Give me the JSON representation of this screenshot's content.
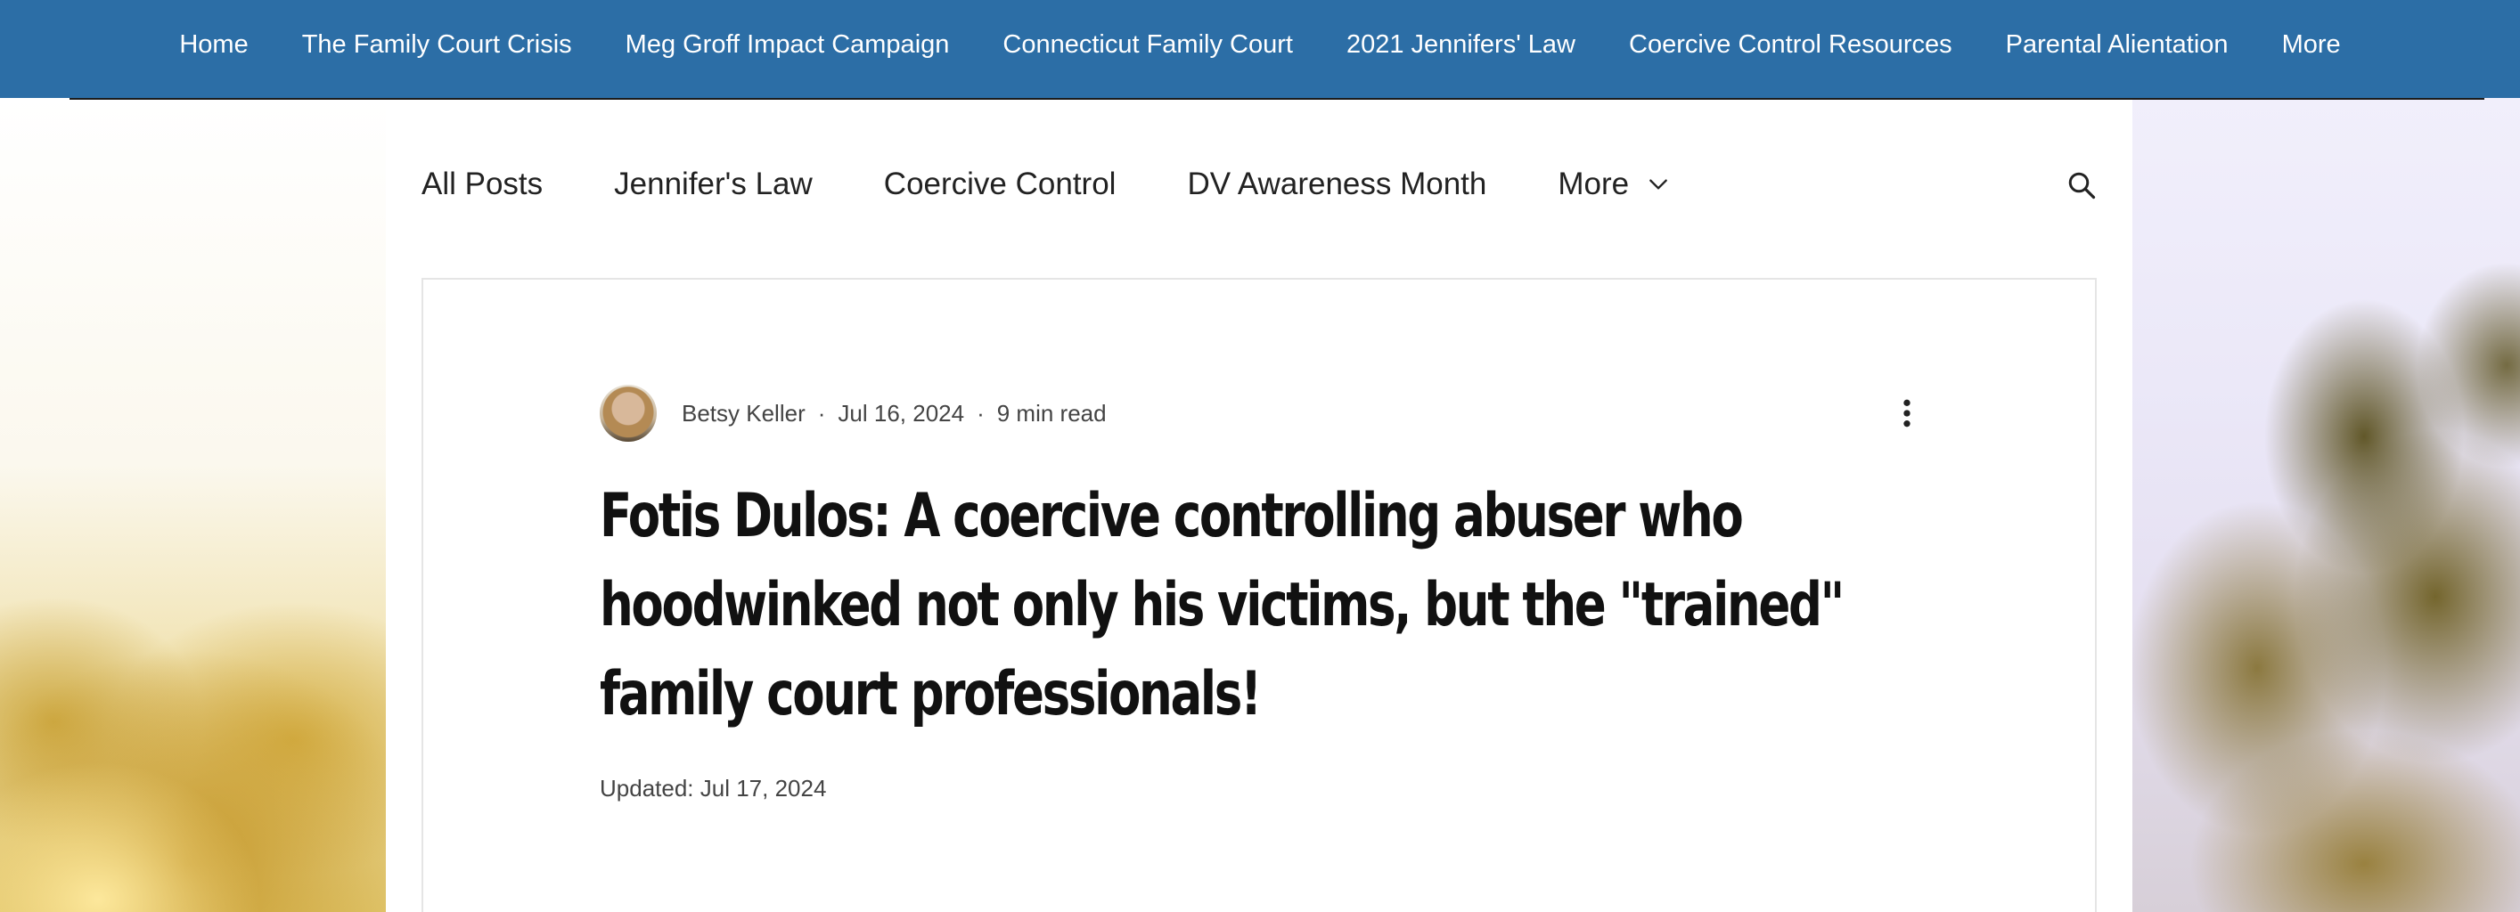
{
  "top_nav": {
    "items": [
      "Home",
      "The Family Court Crisis",
      "Meg Groff Impact Campaign",
      "Connecticut Family Court",
      "2021 Jennifers' Law",
      "Coercive Control Resources",
      "Parental Alientation",
      "More"
    ]
  },
  "blog_nav": {
    "items": [
      "All Posts",
      "Jennifer's Law",
      "Coercive Control",
      "DV Awareness Month"
    ],
    "more_label": "More"
  },
  "post": {
    "author": "Betsy Keller",
    "date": "Jul 16, 2024",
    "read_time": "9 min read",
    "separator": "·",
    "title": "Fotis Dulos: A coercive controlling abuser who hoodwinked not only his victims, but the \"trained\" family court professionals!",
    "updated": "Updated: Jul 17, 2024"
  },
  "icons": {
    "search": "search-icon",
    "more": "more-vert-icon",
    "chevron": "chevron-down-icon"
  },
  "colors": {
    "nav_bg": "#2c6ea6",
    "nav_text": "#ffffff",
    "title": "#111111"
  }
}
